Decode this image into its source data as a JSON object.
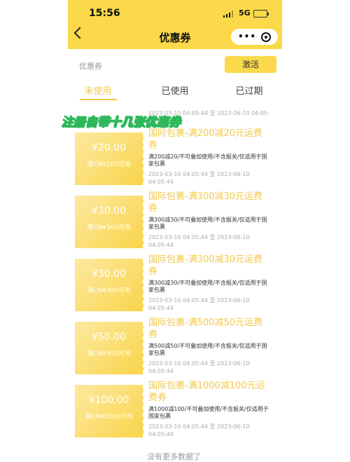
{
  "status_bar": {
    "time": "15:56",
    "network": "5G"
  },
  "header": {
    "title": "优惠券",
    "capsule_dots": "•••"
  },
  "toolbar": {
    "coupon_label": "优惠券",
    "activate_label": "激活"
  },
  "tabs": [
    {
      "label": "未使用",
      "active": true
    },
    {
      "label": "已使用",
      "active": false
    },
    {
      "label": "已过期",
      "active": false
    }
  ],
  "overlay_text": "注册自带十几张优惠券",
  "top_date": "2023-03-10 04:05:44 至 2023-06-10 04:05:",
  "coupons": [
    {
      "amount": "¥20.00",
      "condition": "满CN¥200可用",
      "title": "国际包裹-满200减20元运费券",
      "desc": "满200减20/不可叠加使用/不含报关/仅适用于国家包裹",
      "date": "2023-03-10 04:05:44 至 2023-06-10 04:05:44"
    },
    {
      "amount": "¥30.00",
      "condition": "满CN¥300可用",
      "title": "国际包裹-满300减30元运费券",
      "desc": "满300减30/不可叠加使用/不含报关/仅适用于国家包裹",
      "date": "2023-03-10 04:05:44 至 2023-06-10 04:05:44"
    },
    {
      "amount": "¥30.00",
      "condition": "满CN¥300可用",
      "title": "国际包裹-满300减30元运费券",
      "desc": "满300减30/不可叠加使用/不含报关/仅适用于国家包裹",
      "date": "2023-03-10 04:05:44 至 2023-06-10 04:05:44"
    },
    {
      "amount": "¥50.00",
      "condition": "满CN¥500可用",
      "title": "国际包裹-满500减50元运费券",
      "desc": "满500减50/不可叠加使用/不含报关/仅适用于国家包裹",
      "date": "2023-03-10 04:05:44 至 2023-06-10 04:05:44"
    },
    {
      "amount": "¥100.00",
      "condition": "满CN¥1000可用",
      "title": "国际包裹-满1000减100元运费券",
      "desc": "满1000减100/不可叠加使用/不含报关/仅适用于国家包裹",
      "date": "2023-03-10 04:05:44 至 2023-06-10 04:05:44"
    }
  ],
  "footer": "没有更多数据了",
  "colors": {
    "brand_yellow": "#fbd94a",
    "accent_text": "#f2c94c",
    "overlay_green": "#2fb85a"
  }
}
